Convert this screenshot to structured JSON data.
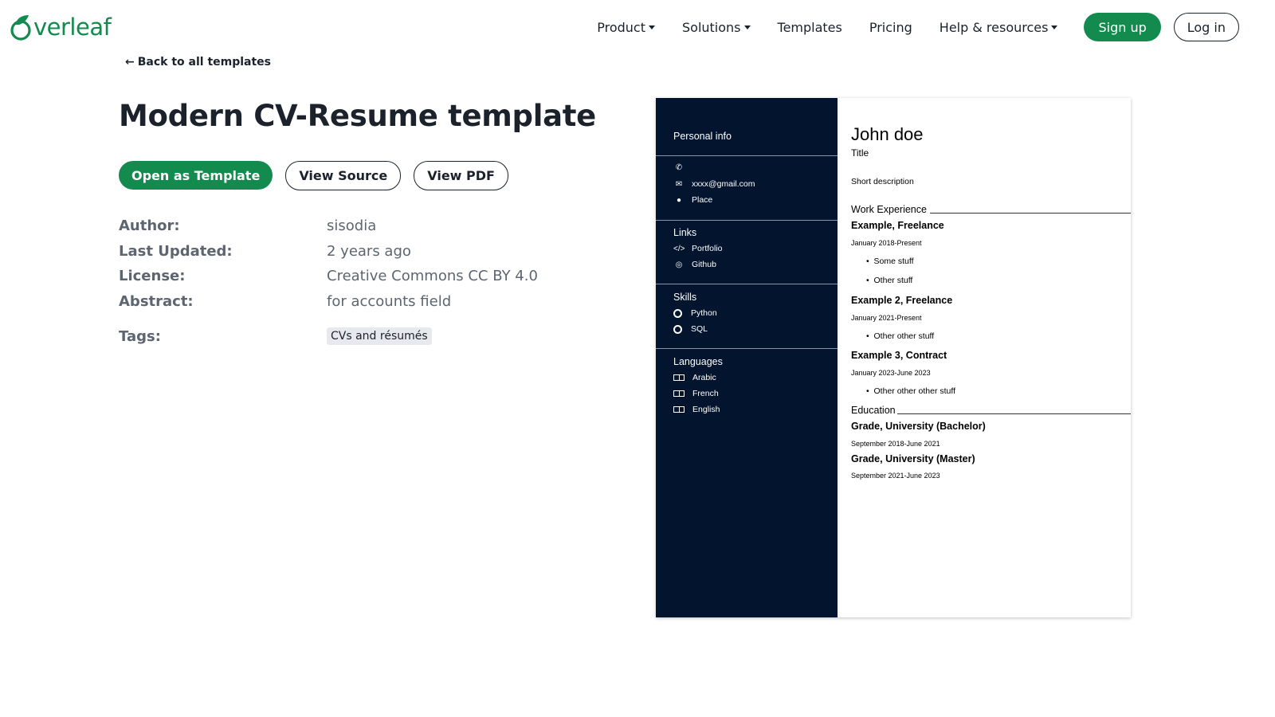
{
  "header": {
    "logo_text": "verleaf",
    "brand_color": "#138a4e",
    "nav": [
      {
        "label": "Product",
        "dropdown": true
      },
      {
        "label": "Solutions",
        "dropdown": true
      },
      {
        "label": "Templates",
        "dropdown": false
      },
      {
        "label": "Pricing",
        "dropdown": false
      },
      {
        "label": "Help & resources",
        "dropdown": true
      }
    ],
    "signup_label": "Sign up",
    "login_label": "Log in"
  },
  "back_link": "Back to all templates",
  "title": "Modern CV-Resume template",
  "actions": {
    "open": "Open as Template",
    "source": "View Source",
    "pdf": "View PDF"
  },
  "meta": {
    "author_label": "Author:",
    "author": "sisodia",
    "updated_label": "Last Updated:",
    "updated": "2 years ago",
    "license_label": "License:",
    "license": "Creative Commons CC BY 4.0",
    "abstract_label": "Abstract:",
    "abstract": "for accounts field",
    "tags_label": "Tags:",
    "tags": [
      "CVs and résumés"
    ]
  },
  "cv": {
    "sidebar_color": "#03142f",
    "personal_title": "Personal info",
    "email": "xxxx@gmail.com",
    "place": "Place",
    "links_title": "Links",
    "link1": "Portfolio",
    "link2": "Github",
    "skills_title": "Skills",
    "skill1": "Python",
    "skill2": "SQL",
    "languages_title": "Languages",
    "lang1": "Arabic",
    "lang2": "French",
    "lang3": "English",
    "name": "John doe",
    "role": "Title",
    "short": "Short description",
    "work_title": "Work Experience",
    "job1": "Example, Freelance",
    "job1_date": "January 2018-Present",
    "job1_b1": "Some stuff",
    "job1_b2": "Other stuff",
    "job2": "Example 2, Freelance",
    "job2_date": "January 2021-Present",
    "job2_b1": "Other other stuff",
    "job3": "Example 3, Contract",
    "job3_date": "January 2023-June 2023",
    "job3_b1": "Other other other stuff",
    "edu_title": "Education",
    "edu1": "Grade, University (Bachelor)",
    "edu1_date": "September 2018-June 2021",
    "edu2": "Grade, University (Master)",
    "edu2_date": "September 2021-June 2023"
  }
}
